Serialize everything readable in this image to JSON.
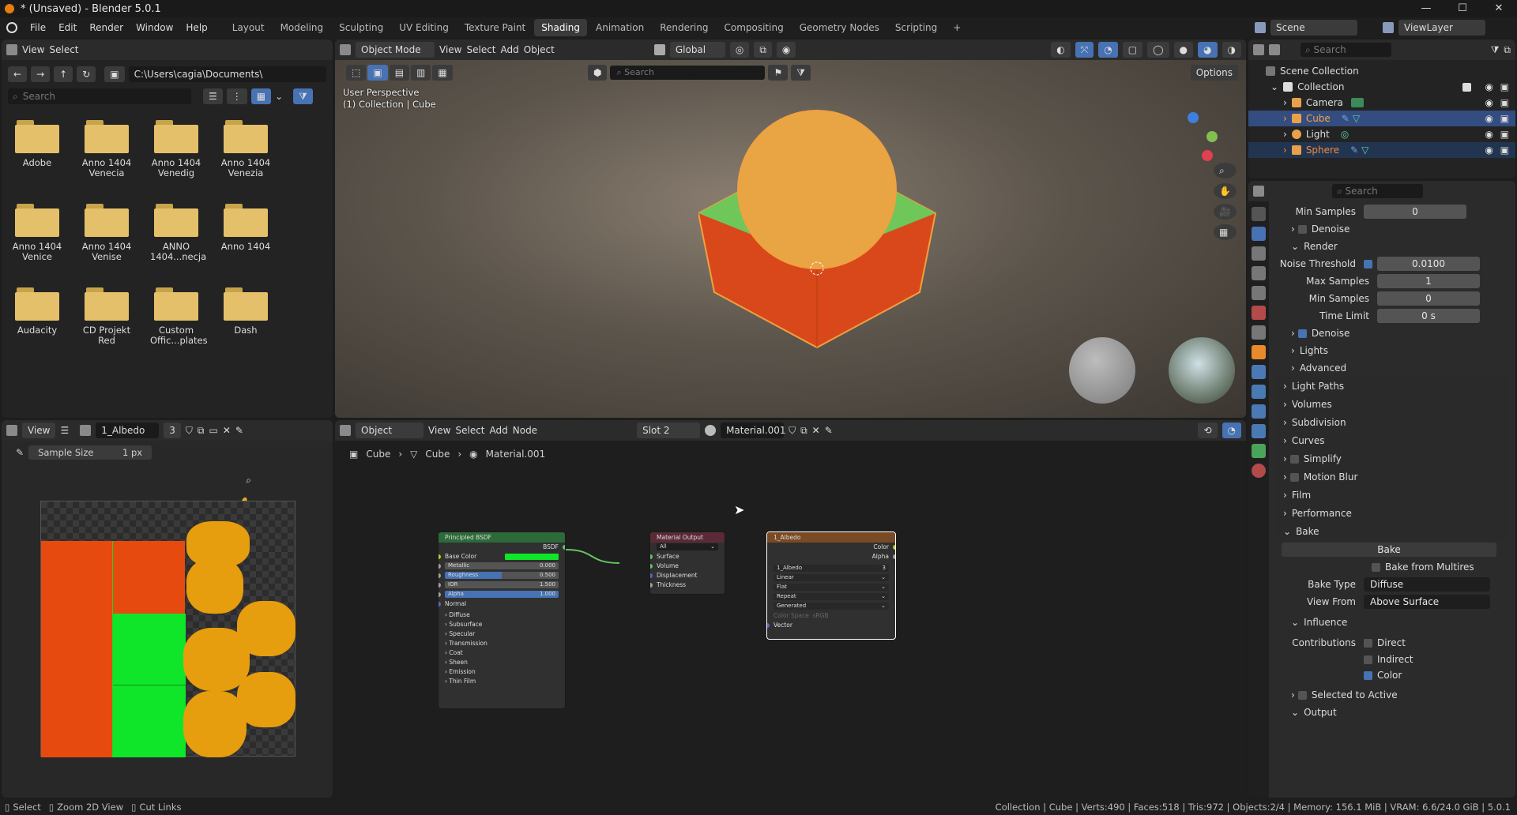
{
  "title": "* (Unsaved) - Blender 5.0.1",
  "window_controls": [
    "—",
    "☐",
    "✕"
  ],
  "menu": [
    "File",
    "Edit",
    "Render",
    "Window",
    "Help"
  ],
  "workspaces": [
    "Layout",
    "Modeling",
    "Sculpting",
    "UV Editing",
    "Texture Paint",
    "Shading",
    "Animation",
    "Rendering",
    "Compositing",
    "Geometry Nodes",
    "Scripting"
  ],
  "active_workspace": "Shading",
  "scene": "Scene",
  "view_layer": "ViewLayer",
  "file_browser": {
    "menu_view": "View",
    "menu_select": "Select",
    "path": "C:\\Users\\cagia\\Documents\\",
    "search_placeholder": "Search",
    "folders": [
      "Adobe",
      "Anno 1404 Venecia",
      "Anno 1404 Venedig",
      "Anno 1404 Venezia",
      "Anno 1404 Venice",
      "Anno 1404 Venise",
      "ANNO 1404...necja",
      "Anno 1404",
      "Audacity",
      "CD Projekt Red",
      "Custom Offic...plates",
      "Dash"
    ]
  },
  "viewport": {
    "mode": "Object Mode",
    "menus": [
      "View",
      "Select",
      "Add",
      "Object"
    ],
    "orientation": "Global",
    "search_placeholder": "Search",
    "options": "Options",
    "overlay_line1": "User Perspective",
    "overlay_line2": "(1) Collection | Cube"
  },
  "image_editor": {
    "view": "View",
    "image_name": "1_Albedo",
    "users": "3",
    "sample_size_label": "Sample Size",
    "sample_size_value": "1 px"
  },
  "node_editor": {
    "object": "Object",
    "menus": [
      "View",
      "Select",
      "Add",
      "Node"
    ],
    "slot": "Slot 2",
    "material": "Material.001",
    "breadcrumb": [
      "Cube",
      "Cube",
      "Material.001"
    ],
    "bsdf": {
      "title": "Principled BSDF",
      "output": "BSDF",
      "base_color": "Base Color",
      "fields": [
        {
          "label": "Metallic",
          "value": "0.000"
        },
        {
          "label": "Roughness",
          "value": "0.500"
        },
        {
          "label": "IOR",
          "value": "1.500"
        },
        {
          "label": "Alpha",
          "value": "1.000"
        }
      ],
      "normal": "Normal",
      "panels": [
        "Diffuse",
        "Subsurface",
        "Specular",
        "Transmission",
        "Coat",
        "Sheen",
        "Emission",
        "Thin Film"
      ]
    },
    "output": {
      "title": "Material Output",
      "target": "All",
      "inputs": [
        "Surface",
        "Volume",
        "Displacement",
        "Thickness"
      ]
    },
    "texture": {
      "title": "1_Albedo",
      "outputs": [
        "Color",
        "Alpha"
      ],
      "image": "1_Albedo",
      "users": "3",
      "interp": "Linear",
      "proj": "Flat",
      "ext": "Repeat",
      "src": "Generated",
      "cs_label": "Color Space",
      "cs_value": "sRGB",
      "vector": "Vector"
    }
  },
  "outliner": {
    "search_placeholder": "Search",
    "root": "Scene Collection",
    "collection": "Collection",
    "items": [
      "Camera",
      "Cube",
      "Light",
      "Sphere"
    ]
  },
  "properties": {
    "search_placeholder": "Search",
    "min_samples_top": {
      "label": "Min Samples",
      "value": "0"
    },
    "denoise1": "Denoise",
    "render": "Render",
    "noise_threshold": {
      "label": "Noise Threshold",
      "value": "0.0100"
    },
    "max_samples": {
      "label": "Max Samples",
      "value": "1"
    },
    "min_samples": {
      "label": "Min Samples",
      "value": "0"
    },
    "time_limit": {
      "label": "Time Limit",
      "value": "0 s"
    },
    "denoise2": "Denoise",
    "lights": "Lights",
    "advanced": "Advanced",
    "panels": [
      "Light Paths",
      "Volumes",
      "Subdivision",
      "Curves",
      "Simplify",
      "Motion Blur",
      "Film",
      "Performance"
    ],
    "bake": "Bake",
    "bake_button": "Bake",
    "bake_multires": "Bake from Multires",
    "bake_type": {
      "label": "Bake Type",
      "value": "Diffuse"
    },
    "view_from": {
      "label": "View From",
      "value": "Above Surface"
    },
    "influence": "Influence",
    "contributions": "Contributions",
    "contrib": [
      "Direct",
      "Indirect",
      "Color"
    ],
    "selected_to_active": "Selected to Active",
    "output": "Output"
  },
  "statusbar": {
    "select": "Select",
    "zoom": "Zoom 2D View",
    "cut": "Cut Links",
    "stats": "Collection | Cube | Verts:490 | Faces:518 | Tris:972 | Objects:2/4 | Memory: 156.1 MiB | VRAM: 6.6/24.0 GiB | 5.0.1"
  }
}
